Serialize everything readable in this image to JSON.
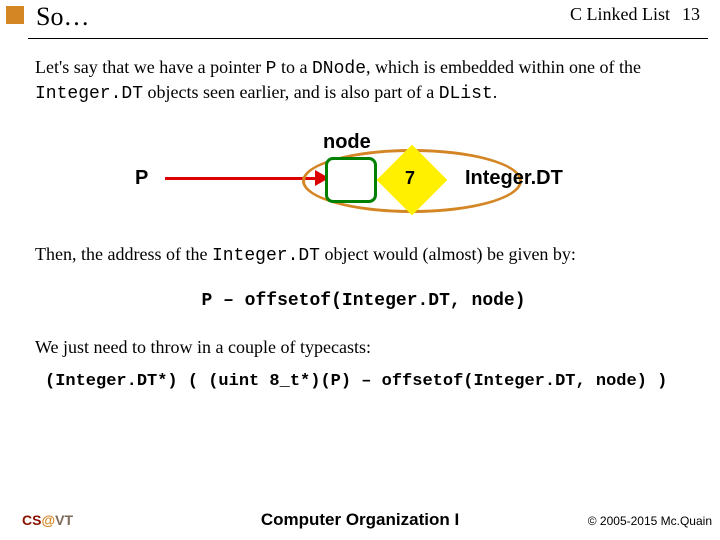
{
  "header": {
    "title": "So…",
    "topic": "C Linked List",
    "page": "13"
  },
  "para1_a": "Let's say that we have a pointer ",
  "para1_code1": "P",
  "para1_b": " to a ",
  "para1_code2": "DNode",
  "para1_c": ", which is embedded within one of the ",
  "para1_code3": "Integer.DT",
  "para1_d": " objects seen earlier, and is also part of a ",
  "para1_code4": "DList",
  "para1_e": ".",
  "diagram": {
    "p": "P",
    "node": "node",
    "value": "7",
    "struct": "Integer.DT"
  },
  "para2_a": "Then, the address of the ",
  "para2_code1": "Integer.DT",
  "para2_b": " object would (almost) be given by:",
  "code1": "P – offsetof(Integer.DT, node)",
  "para3": "We just need to throw in a couple of typecasts:",
  "code2": "(Integer.DT*) ( (uint 8_t*)(P) – offsetof(Integer.DT, node) )",
  "footer": {
    "cs": "CS",
    "at": "@",
    "vt": "VT",
    "course": "Computer Organization I",
    "copyright": "© 2005-2015 Mc.Quain"
  }
}
